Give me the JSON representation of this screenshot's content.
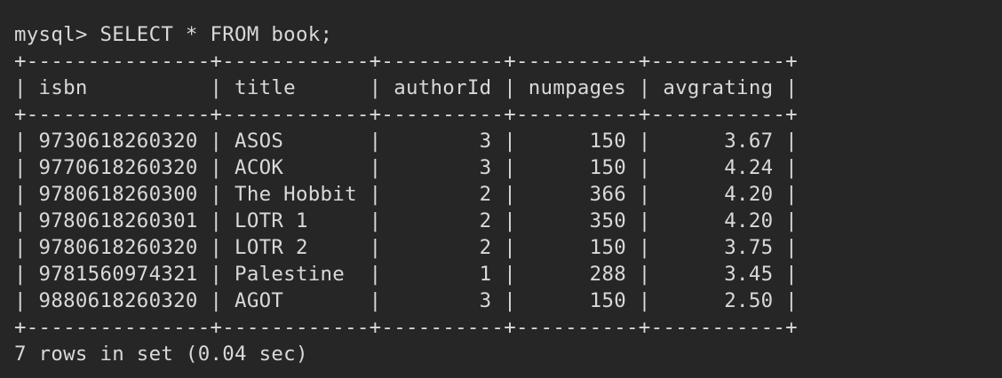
{
  "terminal": {
    "prompt": "mysql> SELECT * FROM book;",
    "separator": "+---------------+------------+----------+----------+-----------+",
    "header": "| isbn          | title      | authorId | numpages | avgrating |",
    "rows": [
      "| 9730618260320 | ASOS       |        3 |      150 |      3.67 |",
      "| 9770618260320 | ACOK       |        3 |      150 |      4.24 |",
      "| 9780618260300 | The Hobbit |        2 |      366 |      4.20 |",
      "| 9780618260301 | LOTR 1     |        2 |      350 |      4.20 |",
      "| 9780618260320 | LOTR 2     |        2 |      150 |      3.75 |",
      "| 9781560974321 | Palestine  |        1 |      288 |      3.45 |",
      "| 9880618260320 | AGOT       |        3 |      150 |      2.50 |"
    ],
    "footer": "7 rows in set (0.04 sec)"
  },
  "colors": {
    "background": "#262626",
    "text": "#d9d9d9"
  }
}
